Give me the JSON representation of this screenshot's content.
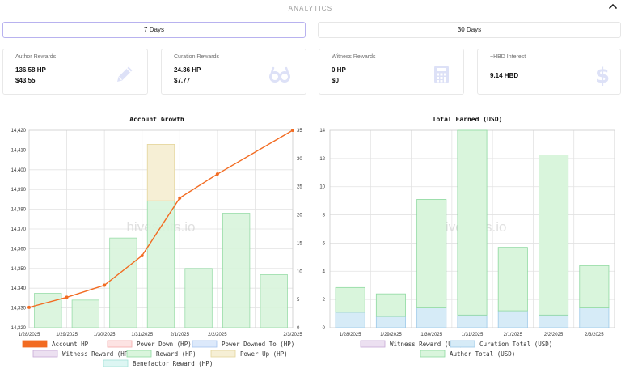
{
  "header": {
    "title": "ANALYTICS"
  },
  "buttons": {
    "seven_days": "7 Days",
    "thirty_days": "30 Days"
  },
  "cards": [
    {
      "title": "Author Rewards",
      "line1": "136.58 HP",
      "line2": "$43.55",
      "icon": "pencil-icon"
    },
    {
      "title": "Curation Rewards",
      "line1": "24.36 HP",
      "line2": "$7.77",
      "icon": "glasses-icon"
    },
    {
      "title": "Witness Rewards",
      "line1": "0 HP",
      "line2": "$0",
      "icon": "calculator-icon"
    },
    {
      "title": "~HBD Interest",
      "line1": "9.14 HBD",
      "line2": "",
      "icon": "dollar-icon"
    }
  ],
  "colors": {
    "accent": "#b8b2ef",
    "icon": "#dde1f7",
    "line": "#f26b21",
    "green_fill": "#d9f5dc",
    "green_stroke": "#8ed9a0",
    "blue_fill": "#d6ebf7",
    "blue_stroke": "#9cc9e8",
    "yellow_fill": "#f6efd5",
    "yellow_stroke": "#e4d59a"
  },
  "chart_data": [
    {
      "type": "bar",
      "title": "Account Growth",
      "watermark": "hivestats.io",
      "categories": [
        "1/28/2025",
        "1/29/2025",
        "1/30/2025",
        "1/31/2025",
        "2/1/2025",
        "2/2/2025",
        "2/3/2025"
      ],
      "ylim_left": [
        14320,
        14420
      ],
      "yticks_left": [
        "14,320",
        "14,330",
        "14,340",
        "14,350",
        "14,360",
        "14,370",
        "14,380",
        "14,390",
        "14,400",
        "14,410",
        "14,420"
      ],
      "ylim_right": [
        0,
        35
      ],
      "yticks_right": [
        "0",
        "5",
        "10",
        "15",
        "20",
        "25",
        "30",
        "35"
      ],
      "series": [
        {
          "name": "Account HP",
          "kind": "line",
          "axis": "left",
          "values": [
            14330.3,
            14335.4,
            14341.5,
            14356.5,
            14385.7,
            14397.8,
            14420
          ]
        },
        {
          "name": "Reward (HP)",
          "kind": "bar",
          "axis": "right",
          "values": [
            6.1,
            4.9,
            15.9,
            22.5,
            10.5,
            20.3,
            9.4
          ]
        },
        {
          "name": "Power Up (HP)",
          "kind": "bar",
          "axis": "right",
          "stack_on": "Reward (HP)",
          "values": [
            0,
            0,
            0,
            10.0,
            0,
            0,
            0
          ]
        }
      ],
      "legend": [
        {
          "label": "Account HP",
          "fill": "#f26b21",
          "stroke": "#f26b21"
        },
        {
          "label": "Power Down (HP)",
          "fill": "#fde3e3",
          "stroke": "#f4a9a9"
        },
        {
          "label": "Power Downed To (HP)",
          "fill": "#dce9fb",
          "stroke": "#a6c4ef"
        },
        {
          "label": "Witness Reward (HP)",
          "fill": "#ece0f1",
          "stroke": "#c7a9d6"
        },
        {
          "label": "Reward (HP)",
          "fill": "#d9f5dc",
          "stroke": "#8ed9a0"
        },
        {
          "label": "Power Up (HP)",
          "fill": "#f6efd5",
          "stroke": "#e4d59a"
        },
        {
          "label": "Benefactor Reward (HP)",
          "fill": "#ddf6f3",
          "stroke": "#a3e2d9"
        }
      ]
    },
    {
      "type": "bar",
      "title": "Total Earned (USD)",
      "watermark": "hivestats.io",
      "categories": [
        "1/28/2025",
        "1/29/2025",
        "1/30/2025",
        "1/31/2025",
        "2/1/2025",
        "2/2/2025",
        "2/3/2025"
      ],
      "ylim": [
        0,
        14
      ],
      "yticks": [
        "0",
        "2",
        "4",
        "6",
        "8",
        "10",
        "12",
        "14"
      ],
      "series": [
        {
          "name": "Witness Reward (USD)",
          "values": [
            0,
            0,
            0,
            0,
            0,
            0,
            0
          ]
        },
        {
          "name": "Curation Total (USD)",
          "values": [
            1.1,
            0.8,
            1.4,
            0.9,
            1.2,
            0.9,
            1.4
          ]
        },
        {
          "name": "Author Total (USD)",
          "values": [
            1.75,
            1.6,
            7.7,
            13.1,
            4.5,
            11.35,
            3.0
          ]
        }
      ],
      "legend": [
        {
          "label": "Witness Reward (USD)",
          "fill": "#ece0f1",
          "stroke": "#c7a9d6"
        },
        {
          "label": "Curation Total (USD)",
          "fill": "#d6ebf7",
          "stroke": "#9cc9e8"
        },
        {
          "label": "Author Total (USD)",
          "fill": "#d9f5dc",
          "stroke": "#8ed9a0"
        }
      ]
    }
  ]
}
